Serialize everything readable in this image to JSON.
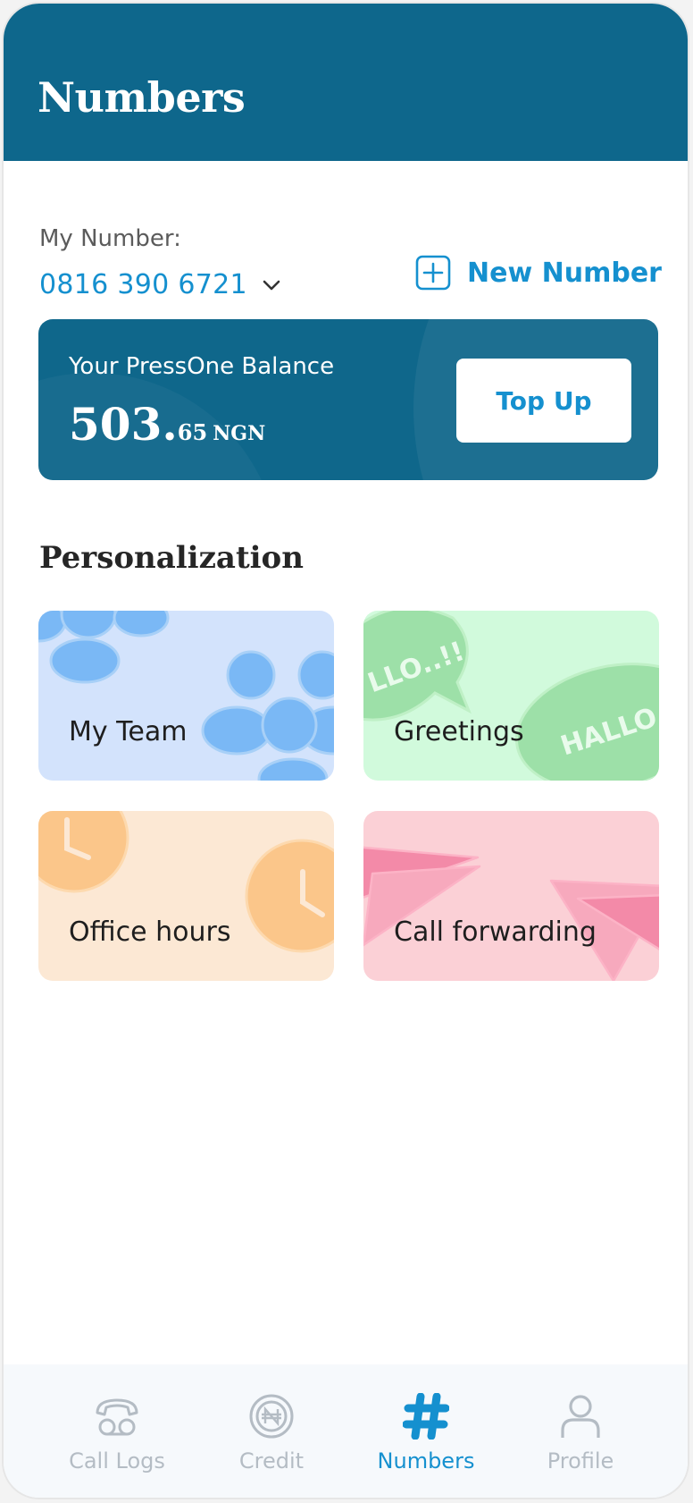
{
  "header": {
    "title": "Numbers"
  },
  "my_number": {
    "label": "My Number:",
    "value": "0816 390 6721"
  },
  "new_number": {
    "label": "New Number"
  },
  "balance": {
    "label": "Your PressOne Balance",
    "amount_int": "503.",
    "amount_dec": "65",
    "currency": "NGN",
    "topup_label": "Top Up"
  },
  "personalization": {
    "title": "Personalization",
    "tiles": [
      {
        "label": "My Team"
      },
      {
        "label": "Greetings"
      },
      {
        "label": "Office hours"
      },
      {
        "label": "Call forwarding"
      }
    ],
    "greeting_art_text_1": "LLO..!!",
    "greeting_art_text_2": "HALLO."
  },
  "nav": {
    "items": [
      {
        "label": "Call Logs",
        "icon": "phone-icon"
      },
      {
        "label": "Credit",
        "icon": "naira-coin-icon"
      },
      {
        "label": "Numbers",
        "icon": "hash-icon"
      },
      {
        "label": "Profile",
        "icon": "user-icon"
      }
    ],
    "active": "Numbers"
  },
  "colors": {
    "brand": "#0e678c",
    "accent": "#1590cf",
    "team_tile": "#d3e3fc",
    "greetings_tile": "#d1fadc",
    "office_tile": "#fce8d4",
    "call_tile": "#fbd0d6"
  }
}
